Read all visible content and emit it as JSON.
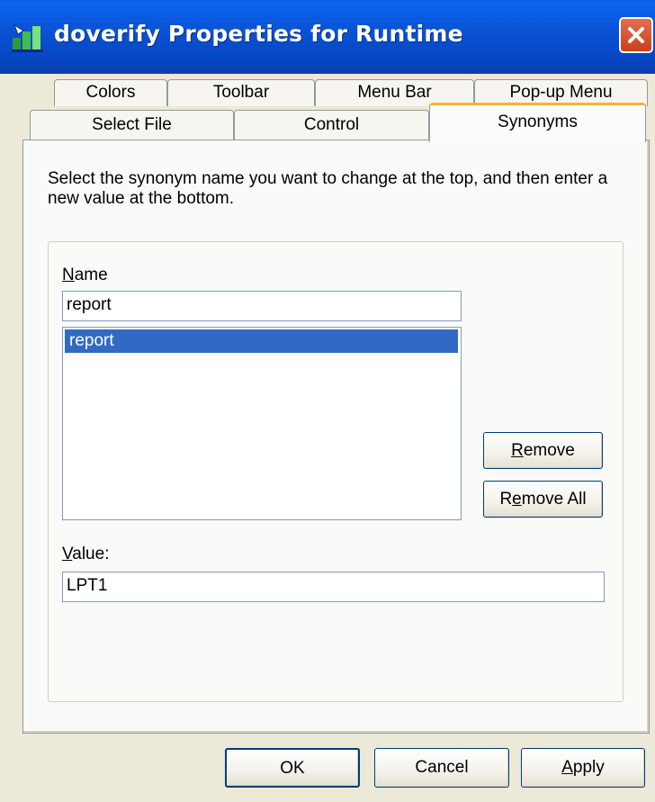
{
  "window": {
    "title": "doverify Properties for Runtime",
    "app_icon": "doverify-app-icon",
    "close_icon": "close-icon"
  },
  "tabs": {
    "back_row": [
      "Colors",
      "Toolbar",
      "Menu Bar",
      "Pop-up Menu"
    ],
    "front_row": [
      "Select File",
      "Control",
      "Synonyms"
    ],
    "active": "Synonyms"
  },
  "synonyms": {
    "instructions": "Select the synonym name you want to change at the top, and then enter a new value at the bottom.",
    "name_label": "Name",
    "name_value": "report",
    "list_items": [
      "report"
    ],
    "selected_item": "report",
    "remove_label": "Remove",
    "remove_all_label": "Remove All",
    "value_label": "Value:",
    "value_value": "LPT1"
  },
  "buttons": {
    "ok_label": "OK",
    "cancel_label": "Cancel",
    "apply_label": "Apply"
  },
  "colors": {
    "titlebar": "#0a55d8",
    "dialog_bg": "#ece9d8",
    "selection": "#316ac5",
    "active_tab_accent": "#f6b23e"
  }
}
